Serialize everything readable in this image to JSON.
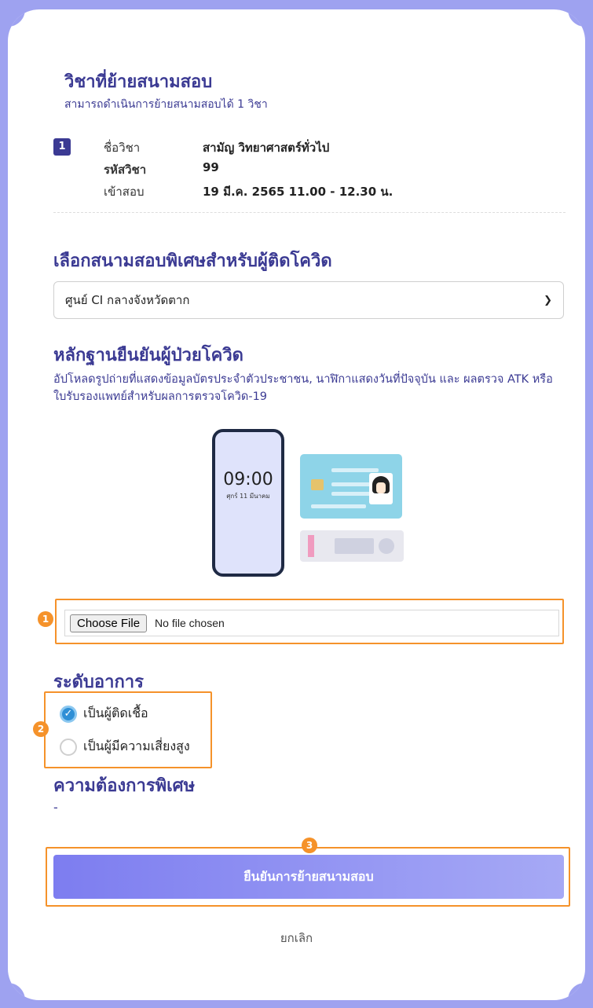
{
  "subject": {
    "title": "วิชาที่ย้ายสนามสอบ",
    "subtitle": "สามารถดำเนินการย้ายสนามสอบได้ 1 วิชา",
    "index": "1",
    "name_label": "ชื่อวิชา",
    "name_value": "สามัญ วิทยาศาสตร์ทั่วไป",
    "code_label": "รหัสวิชา",
    "code_value": "99",
    "exam_label": "เข้าสอบ",
    "exam_value": "19 มี.ค. 2565 11.00 - 12.30 น."
  },
  "venue": {
    "title": "เลือกสนามสอบพิเศษสำหรับผู้ติดโควิด",
    "selected": "ศูนย์ CI กลางจังหวัดตาก"
  },
  "proof": {
    "title": "หลักฐานยืนยันผู้ป่วยโควิด",
    "description": "อัปโหลดรูปถ่ายที่แสดงข้อมูลบัตรประจำตัวประชาชน, นาฬิกาแสดงวันที่ปัจจุบัน และ ผลตรวจ ATK หรือใบรับรองแพทย์สำหรับผลการตรวจโควิด-19",
    "phone_time": "09:00",
    "phone_date": "ศุกร์ 11 มีนาคม",
    "file_button": "Choose File",
    "file_status": "No file chosen"
  },
  "symptom": {
    "title": "ระดับอาการ",
    "options": [
      {
        "label": "เป็นผู้ติดเชื้อ",
        "checked": true
      },
      {
        "label": "เป็นผู้มีความเสี่ยงสูง",
        "checked": false
      }
    ]
  },
  "special": {
    "title": "ความต้องการพิเศษ",
    "value": "-"
  },
  "actions": {
    "confirm": "ยืนยันการย้ายสนามสอบ",
    "cancel": "ยกเลิก"
  },
  "annotations": [
    "1",
    "2",
    "3"
  ],
  "colors": {
    "background": "#9ea2f0",
    "heading": "#3b3a93",
    "highlight": "#f5922a",
    "button": "#7d7df0"
  }
}
